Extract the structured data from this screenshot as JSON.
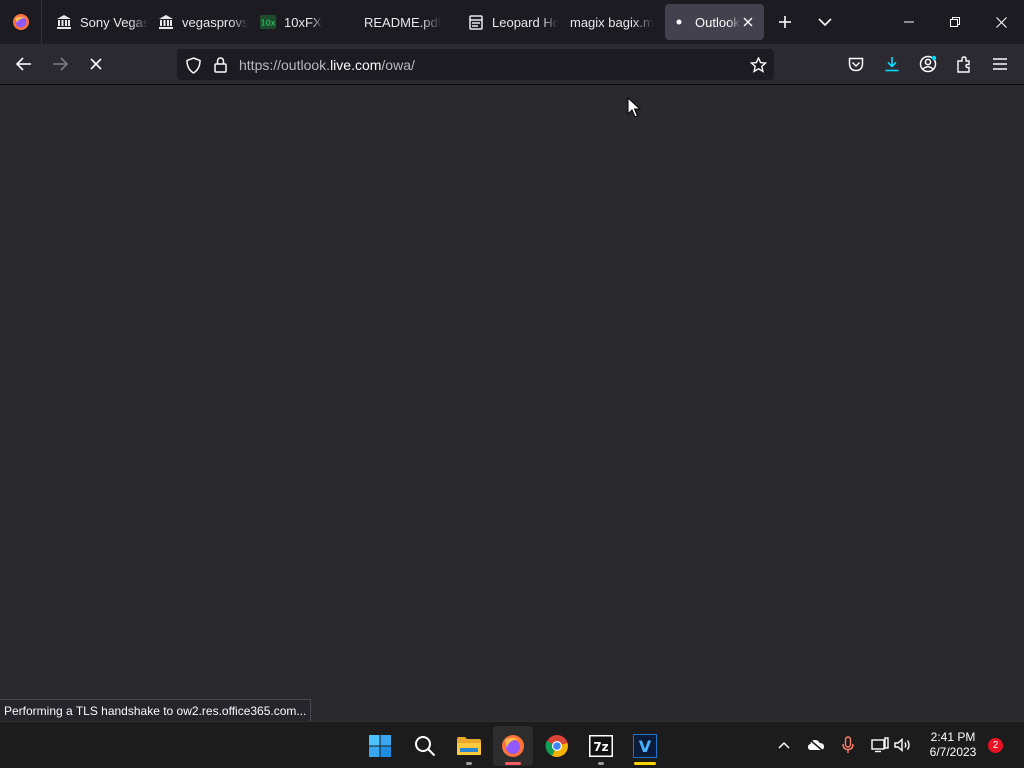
{
  "browser": {
    "tabs": [
      {
        "title": "Sony Vegas",
        "icon": "bank-icon"
      },
      {
        "title": "vegasprovs",
        "icon": "bank-icon"
      },
      {
        "title": "10xFX",
        "icon": "10xfx-icon"
      },
      {
        "title": "README.pdf",
        "icon": "pdf-icon"
      },
      {
        "title": "Leopard Ho",
        "icon": "document-icon"
      },
      {
        "title": "magix bagix.m",
        "icon": "page-icon"
      },
      {
        "title": "Outlook",
        "icon": "loading-dot-icon",
        "active": true
      }
    ],
    "url": {
      "prefix": "https://outlook.",
      "domain": "live.com",
      "path": "/owa/"
    }
  },
  "content": {
    "status": "Performing a TLS handshake to ow2.res.office365.com..."
  },
  "taskbar": {
    "apps": [
      "start",
      "search",
      "file-explorer",
      "firefox",
      "chrome",
      "7zip",
      "vegas-pro"
    ],
    "notifications": "2",
    "clock": {
      "time": "2:41 PM",
      "date": "6/7/2023"
    }
  },
  "colors": {
    "download_accent": "#00ddff",
    "active_indicator": "#f45b69",
    "vegas_indicator": "#ffd500",
    "notification_badge": "#e81123"
  }
}
